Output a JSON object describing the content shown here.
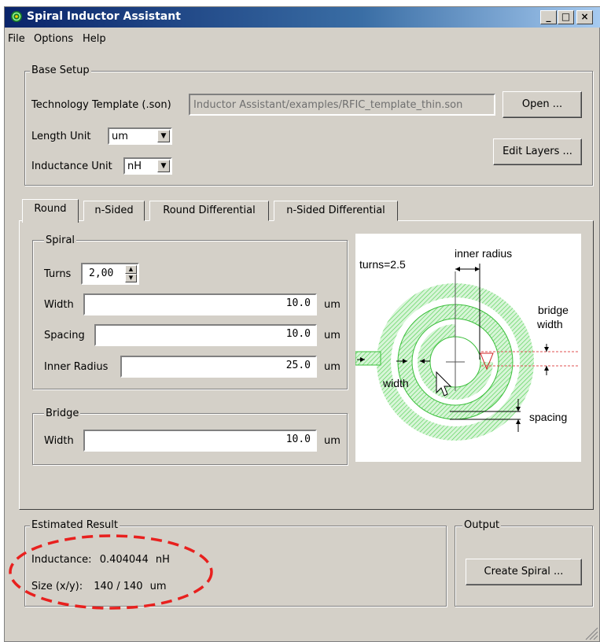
{
  "window": {
    "title": "Spiral Inductor Assistant"
  },
  "menu": [
    "File",
    "Options",
    "Help"
  ],
  "base_setup": {
    "label": "Base Setup",
    "tech_label": "Technology Template (.son)",
    "tech_value": "Inductor Assistant/examples/RFIC_template_thin.son",
    "open_button": "Open ...",
    "length_unit_label": "Length Unit",
    "length_unit_value": "um",
    "inductance_unit_label": "Inductance Unit",
    "inductance_unit_value": "nH",
    "edit_layers_button": "Edit Layers ..."
  },
  "tabs": [
    "Round",
    "n-Sided",
    "Round Differential",
    "n-Sided Differential"
  ],
  "spiral": {
    "label": "Spiral",
    "turns_label": "Turns",
    "turns_value": "2,00",
    "width_label": "Width",
    "width_value": "10.0",
    "spacing_label": "Spacing",
    "spacing_value": "10.0",
    "inner_radius_label": "Inner Radius",
    "inner_radius_value": "25.0",
    "unit": "um"
  },
  "bridge": {
    "label": "Bridge",
    "width_label": "Width",
    "width_value": "10.0",
    "unit": "um"
  },
  "diagram": {
    "turns_text": "turns=2.5",
    "inner_radius_text": "inner radius",
    "bridge_text_1": "bridge",
    "bridge_text_2": "width",
    "width_text": "width",
    "spacing_text": "spacing"
  },
  "result": {
    "label": "Estimated Result",
    "inductance_label": "Inductance:",
    "inductance_value": "0.404044",
    "inductance_unit": "nH",
    "size_label": "Size (x/y):",
    "size_value": "140 / 140",
    "size_unit": "um"
  },
  "output": {
    "label": "Output",
    "create_button": "Create Spiral ..."
  },
  "colors": {
    "accent_title": "#0a246a",
    "spiral_green": "#44cc44",
    "annotation_red": "#e8201e"
  }
}
